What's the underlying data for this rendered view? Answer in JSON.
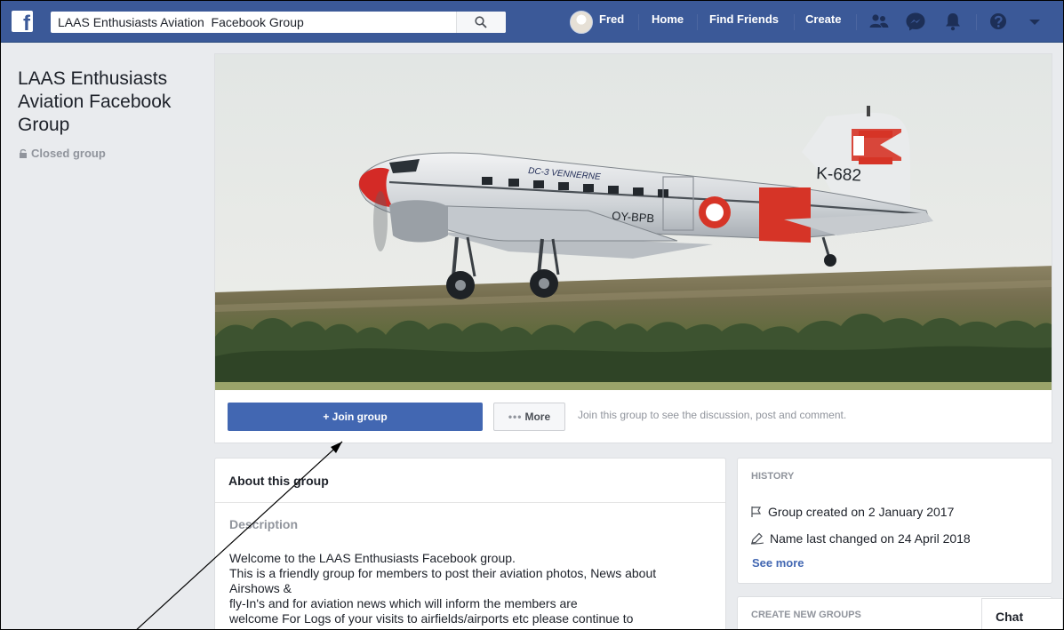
{
  "topbar": {
    "search_value": "LAAS Enthusiasts Aviation  Facebook Group",
    "user_name": "Fred",
    "nav_home": "Home",
    "nav_find_friends": "Find Friends",
    "nav_create": "Create",
    "icons": [
      "friend-requests-icon",
      "messenger-icon",
      "notifications-icon",
      "help-icon",
      "account-menu-icon"
    ]
  },
  "group": {
    "name": "LAAS Enthusiasts Aviation Facebook Group",
    "privacy": "Closed group"
  },
  "cover": {
    "aircraft_lettering": "DC-3 VENNERNE",
    "registration": "OY-BPB",
    "tail_code": "K-682"
  },
  "actions": {
    "join_label": "+ Join group",
    "more_label": "More",
    "hint": "Join this group to see the discussion, post and comment."
  },
  "about": {
    "title": "About this group",
    "description_label": "Description",
    "description_text": " Welcome to the LAAS Enthusiasts Facebook group.\nThis is a friendly group for members to  post  their aviation photos,  News about  Airshows &\n fly-In's and for aviation news which will inform the members are\nwelcome For Logs of your visits to airfields/airports etc please continue to"
  },
  "history": {
    "title": "HISTORY",
    "created": "Group created on 2 January 2017",
    "name_changed": "Name last changed on 24 April 2018",
    "see_more": "See more"
  },
  "create_groups": {
    "title": "CREATE NEW GROUPS"
  },
  "chat": {
    "label": "Chat"
  },
  "colors": {
    "brand": "#3b5998",
    "button": "#4267b2",
    "background": "#e9ebee"
  }
}
